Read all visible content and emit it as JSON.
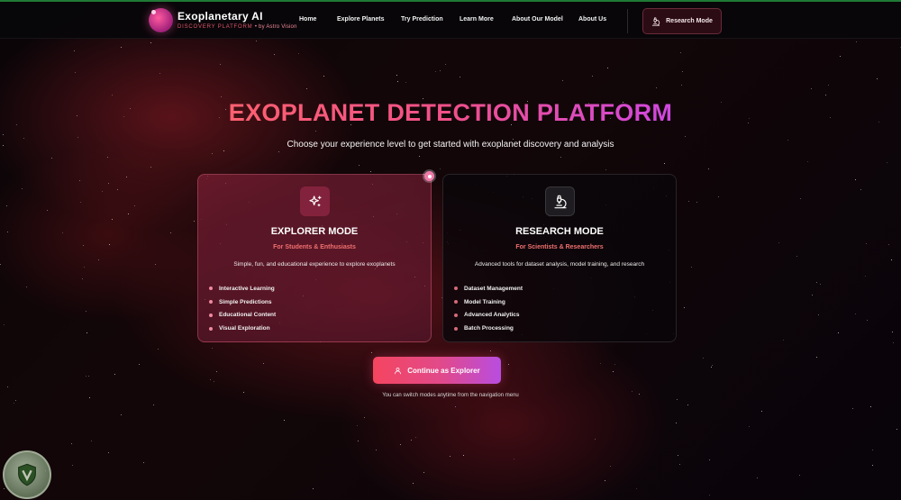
{
  "brand": {
    "title": "Exoplanetary AI",
    "subtitle": "DISCOVERY PLATFORM",
    "by": "• by Astro Vision"
  },
  "nav": {
    "links": [
      "Home",
      "Explore Planets",
      "Try Prediction",
      "Learn More",
      "About Our Model",
      "About Us"
    ],
    "research_button": "Research Mode"
  },
  "hero": {
    "title": "EXOPLANET DETECTION PLATFORM",
    "subtitle": "Choose your experience level to get started with exoplanet discovery and analysis"
  },
  "cards": [
    {
      "title": "EXPLORER MODE",
      "tag": "For Students & Enthusiasts",
      "description": "Simple, fun, and educational experience to explore exoplanets",
      "features": [
        "Interactive Learning",
        "Simple Predictions",
        "Educational Content",
        "Visual Exploration"
      ],
      "icon": "sparkles-icon",
      "selected": true
    },
    {
      "title": "RESEARCH MODE",
      "tag": "For Scientists & Researchers",
      "description": "Advanced tools for dataset analysis, model training, and research",
      "features": [
        "Dataset Management",
        "Model Training",
        "Advanced Analytics",
        "Batch Processing"
      ],
      "icon": "microscope-icon",
      "selected": false
    }
  ],
  "cta": {
    "label": "Continue as Explorer",
    "icon": "user-icon"
  },
  "note": "You can switch modes anytime from the navigation menu",
  "colors": {
    "accent_start": "#f5455f",
    "accent_mid": "#e04a8c",
    "accent_end": "#b84de0",
    "tag_red": "#f07070",
    "background": "#050308"
  }
}
